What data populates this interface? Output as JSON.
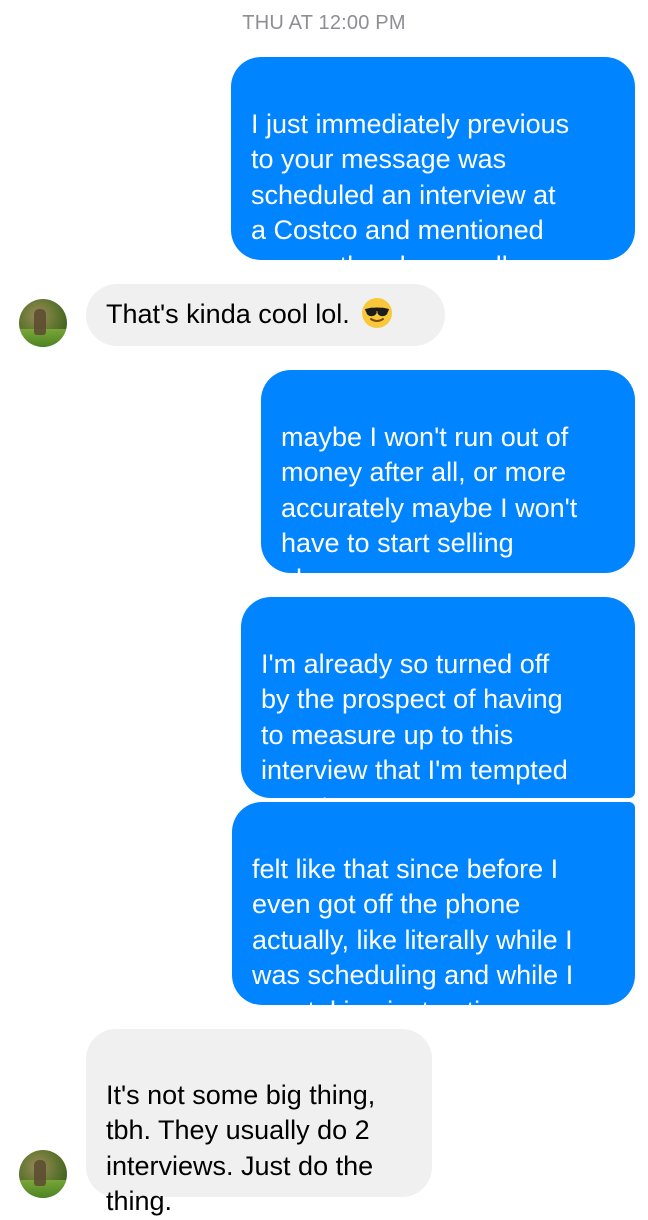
{
  "thread": {
    "timestamp": "THU AT 12:00 PM",
    "messages": [
      {
        "sender": "me",
        "text": "I just immediately previous\nto your message was\nscheduled an interview at\na Costco and mentioned\nyou on the phone call"
      },
      {
        "sender": "contact",
        "text": "That's kinda cool lol.",
        "emoji": "smiling-face-with-sunglasses"
      },
      {
        "sender": "me",
        "text": "maybe I won't run out of\nmoney after all, or more\naccurately maybe I won't\nhave to start selling\nplasma"
      },
      {
        "sender": "me",
        "text": "I'm already so turned off\nby the prospect of having\nto measure up to this\ninterview that I'm tempted\nto not even go"
      },
      {
        "sender": "me",
        "text": "felt like that since before I\neven got off the phone\nactually, like literally while I\nwas scheduling and while I\nwas taking instructions"
      },
      {
        "sender": "contact",
        "text": "It's not some big thing,\ntbh. They usually do 2\ninterviews. Just do the\nthing."
      }
    ]
  },
  "colors": {
    "outgoing_bubble": "#0084ff",
    "incoming_bubble": "#f1f0f0",
    "timestamp": "#8e8e93"
  }
}
